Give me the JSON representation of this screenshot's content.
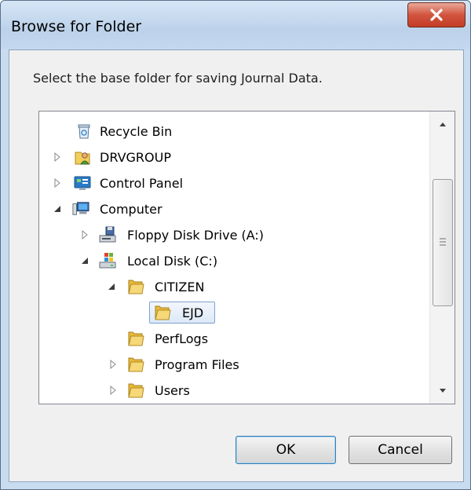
{
  "window": {
    "title": "Browse for Folder",
    "close_label": "X"
  },
  "dialog": {
    "prompt": "Select the base folder for saving Journal Data."
  },
  "tree": {
    "items": [
      {
        "label": "Recycle Bin",
        "icon": "recycle-bin-icon",
        "expander": "none"
      },
      {
        "label": "DRVGROUP",
        "icon": "user-folder-icon",
        "expander": "collapsed"
      },
      {
        "label": "Control Panel",
        "icon": "control-panel-icon",
        "expander": "collapsed"
      },
      {
        "label": "Computer",
        "icon": "computer-icon",
        "expander": "expanded"
      },
      {
        "label": "Floppy Disk Drive (A:)",
        "icon": "floppy-drive-icon",
        "expander": "collapsed"
      },
      {
        "label": "Local Disk (C:)",
        "icon": "local-disk-icon",
        "expander": "expanded"
      },
      {
        "label": "CITIZEN",
        "icon": "folder-icon",
        "expander": "expanded"
      },
      {
        "label": "EJD",
        "icon": "folder-icon",
        "expander": "none",
        "selected": true
      },
      {
        "label": "PerfLogs",
        "icon": "folder-icon",
        "expander": "none"
      },
      {
        "label": "Program Files",
        "icon": "folder-icon",
        "expander": "collapsed"
      },
      {
        "label": "Users",
        "icon": "folder-icon",
        "expander": "collapsed"
      }
    ]
  },
  "buttons": {
    "ok": "OK",
    "cancel": "Cancel"
  }
}
